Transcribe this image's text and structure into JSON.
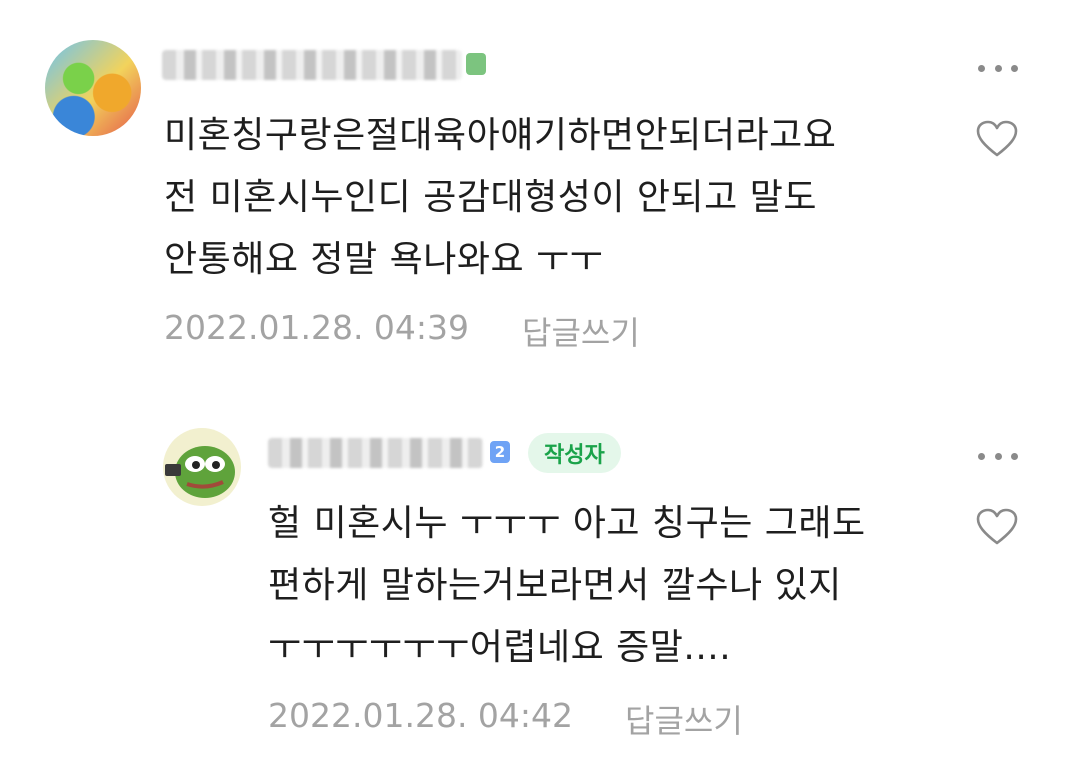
{
  "comments": [
    {
      "text": "미혼칭구랑은절대육아얘기하면안되더라고요\n전 미혼시누인디 공감대형성이 안되고 말도\n안통해요 정말 욕나와요 ㅜㅜ",
      "timestamp": "2022.01.28. 04:39",
      "reply_label": "답글쓰기"
    },
    {
      "badge": "작성자",
      "level": "2",
      "text": "헐 미혼시누 ㅜㅜㅜ 아고 칭구는 그래도\n편하게 말하는거보라면서 깔수나 있지\nㅜㅜㅜㅜㅜㅜ어렵네요 증말....",
      "timestamp": "2022.01.28. 04:42",
      "reply_label": "답글쓰기"
    }
  ],
  "colors": {
    "author_badge_bg": "#e4f7ea",
    "author_badge_text": "#1aa34a",
    "level_badge": "#6fa3f5",
    "meta_text": "#a3a3a3"
  },
  "icons": [
    "more-icon",
    "heart-icon"
  ]
}
